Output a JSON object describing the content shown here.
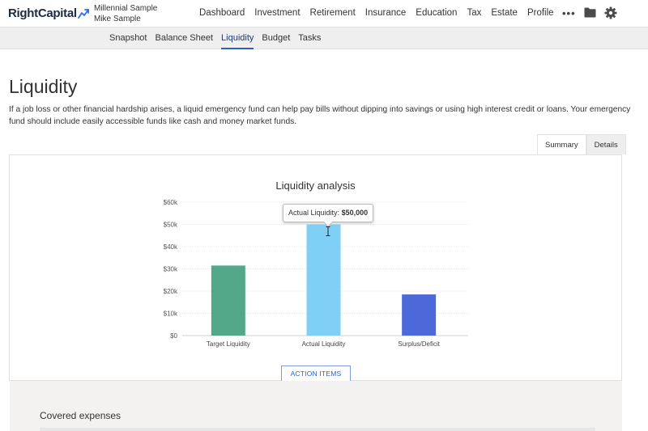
{
  "app": {
    "logo_text": "RightCapital",
    "clients": [
      "Millennial Sample",
      "Mike Sample"
    ]
  },
  "main_nav": [
    {
      "label": "Dashboard",
      "active": true
    },
    {
      "label": "Investment",
      "active": false
    },
    {
      "label": "Retirement",
      "active": false
    },
    {
      "label": "Insurance",
      "active": false
    },
    {
      "label": "Education",
      "active": false
    },
    {
      "label": "Tax",
      "active": false
    },
    {
      "label": "Estate",
      "active": false
    },
    {
      "label": "Profile",
      "active": false
    }
  ],
  "toolbar_icons": [
    "more-icon",
    "folder-icon",
    "gear-icon"
  ],
  "sub_nav": [
    {
      "label": "Snapshot",
      "active": false
    },
    {
      "label": "Balance Sheet",
      "active": false
    },
    {
      "label": "Liquidity",
      "active": true
    },
    {
      "label": "Budget",
      "active": false
    },
    {
      "label": "Tasks",
      "active": false
    }
  ],
  "page": {
    "title": "Liquidity",
    "description": "If a job loss or other financial hardship arises, a liquid emergency fund can help pay bills without dipping into savings or using high interest credit or loans. Your emergency fund should include easily accessible funds like cash and money market funds."
  },
  "tabs": [
    {
      "label": "Summary",
      "active": true
    },
    {
      "label": "Details",
      "active": false
    }
  ],
  "chart_data": {
    "type": "bar",
    "title": "Liquidity analysis",
    "categories": [
      "Target Liquidity",
      "Actual Liquidity",
      "Surplus/Deficit"
    ],
    "values": [
      31500,
      50000,
      18500
    ],
    "colors": [
      "#52a889",
      "#7fd0f4",
      "#4d68d8"
    ],
    "ylim": [
      0,
      60000
    ],
    "yticks": [
      0,
      10000,
      20000,
      30000,
      40000,
      50000,
      60000
    ],
    "ytick_labels": [
      "$0",
      "$10k",
      "$20k",
      "$30k",
      "$40k",
      "$50k",
      "$60k"
    ],
    "grid": true,
    "xlabel": "",
    "ylabel": ""
  },
  "tooltip": {
    "label": "Actual Liquidity:",
    "value": "$50,000"
  },
  "action_button": {
    "label": "ACTION ITEMS"
  },
  "covered_section": {
    "title": "Covered expenses"
  }
}
